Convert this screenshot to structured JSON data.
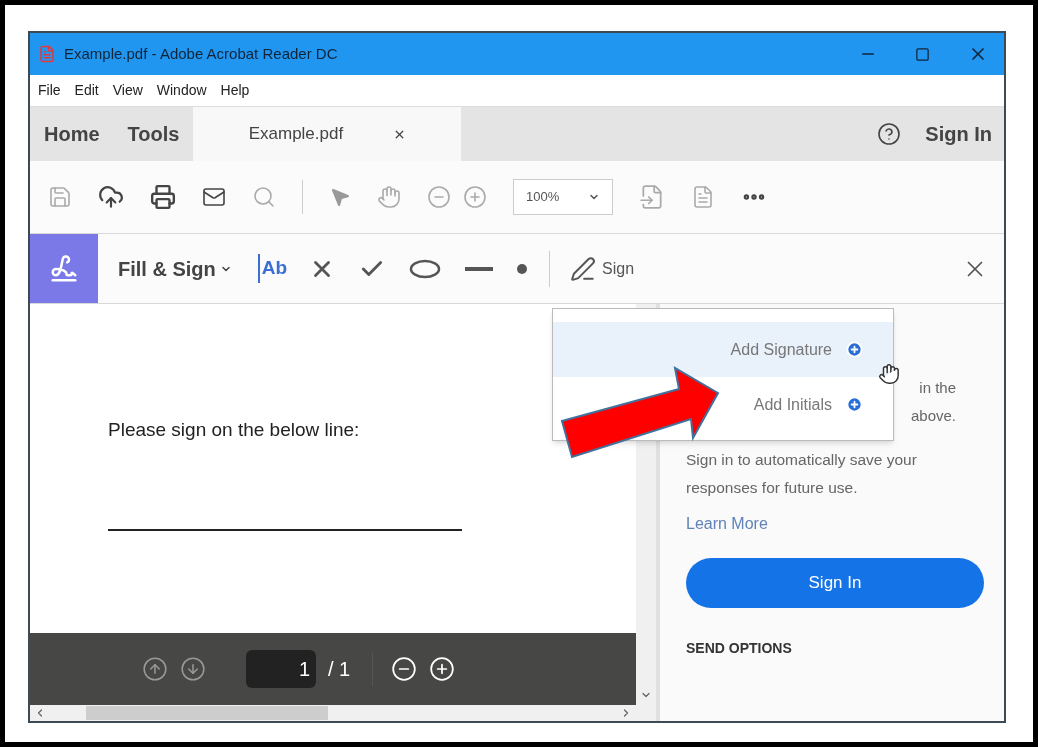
{
  "window": {
    "title": "Example.pdf - Adobe Acrobat Reader DC"
  },
  "menu": [
    "File",
    "Edit",
    "View",
    "Window",
    "Help"
  ],
  "tabs": [
    {
      "label": "Home",
      "selected": false,
      "closable": false
    },
    {
      "label": "Tools",
      "selected": false,
      "closable": false
    },
    {
      "label": "Example.pdf",
      "selected": true,
      "closable": true
    }
  ],
  "account": {
    "sign_in": "Sign In"
  },
  "toolbar": {
    "zoom": "100%"
  },
  "fill_sign": {
    "title": "Fill & Sign",
    "text_tool_label": "Ab",
    "sign_label": "Sign"
  },
  "document": {
    "text": "Please sign on the below line:"
  },
  "page_nav": {
    "current": "1",
    "total": "/ 1"
  },
  "signature_menu": [
    {
      "label": "Add Signature",
      "selected": true
    },
    {
      "label": "Add Initials",
      "selected": false
    }
  ],
  "right_panel": {
    "covered_lines": [
      "in the",
      "above."
    ],
    "message": "Sign in to automatically save your responses for future use.",
    "link": "Learn More",
    "button": "Sign In",
    "section_heading": "SEND OPTIONS"
  }
}
